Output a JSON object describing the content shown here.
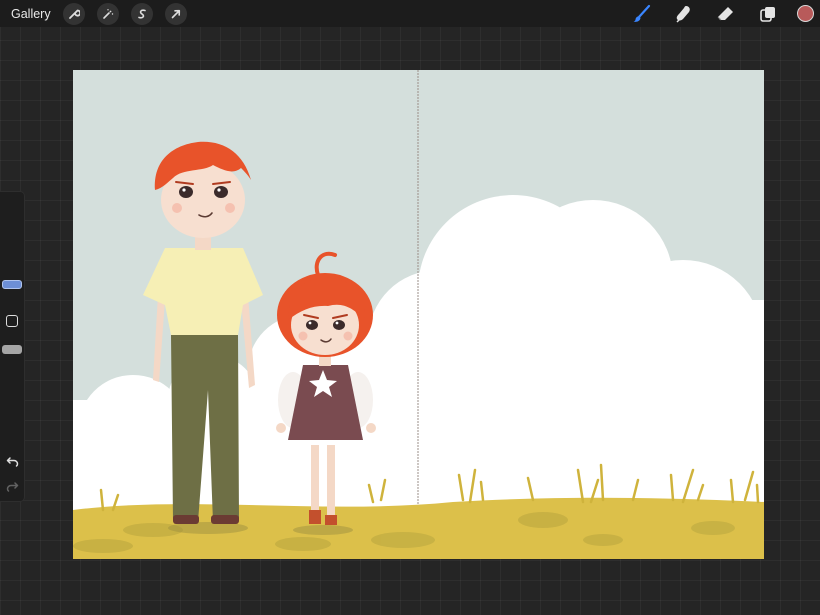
{
  "topbar": {
    "gallery_label": "Gallery",
    "tools_left": [
      "wrench-icon",
      "magic-wand-icon",
      "selection-icon",
      "transform-arrow-icon"
    ],
    "tools_right": [
      "brush-icon",
      "smudge-icon",
      "eraser-icon",
      "layers-icon"
    ],
    "current_color": "#b85a5a",
    "active_tool_color": "#3a86ff"
  },
  "sidebar": {
    "size_handle_color": "#6d8fd6",
    "opacity_handle_color": "#a5a5a5"
  },
  "canvas": {
    "sky_color": "#d4dfdc",
    "cloud_color": "#ffffff",
    "grass_color": "#dcc04a",
    "hair_color": "#e8532a"
  }
}
